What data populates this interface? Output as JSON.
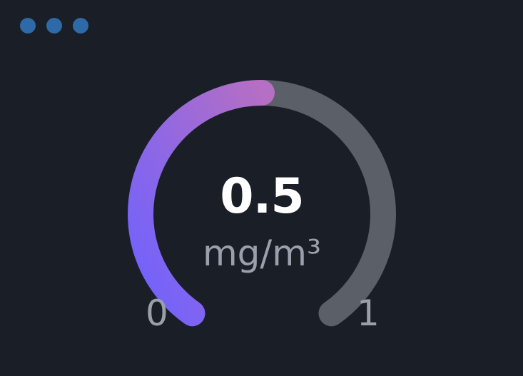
{
  "window_controls": {
    "dots": [
      "dot",
      "dot",
      "dot"
    ],
    "color": "#2e6aa8"
  },
  "gauge": {
    "value_text": "0.5",
    "unit": "mg/m³",
    "min_label": "0",
    "max_label": "1",
    "min": 0,
    "max": 1,
    "value": 0.5,
    "track_color": "#5a5f68",
    "fill_gradient_start": "#6e61ff",
    "fill_gradient_end": "#b56fc4"
  }
}
